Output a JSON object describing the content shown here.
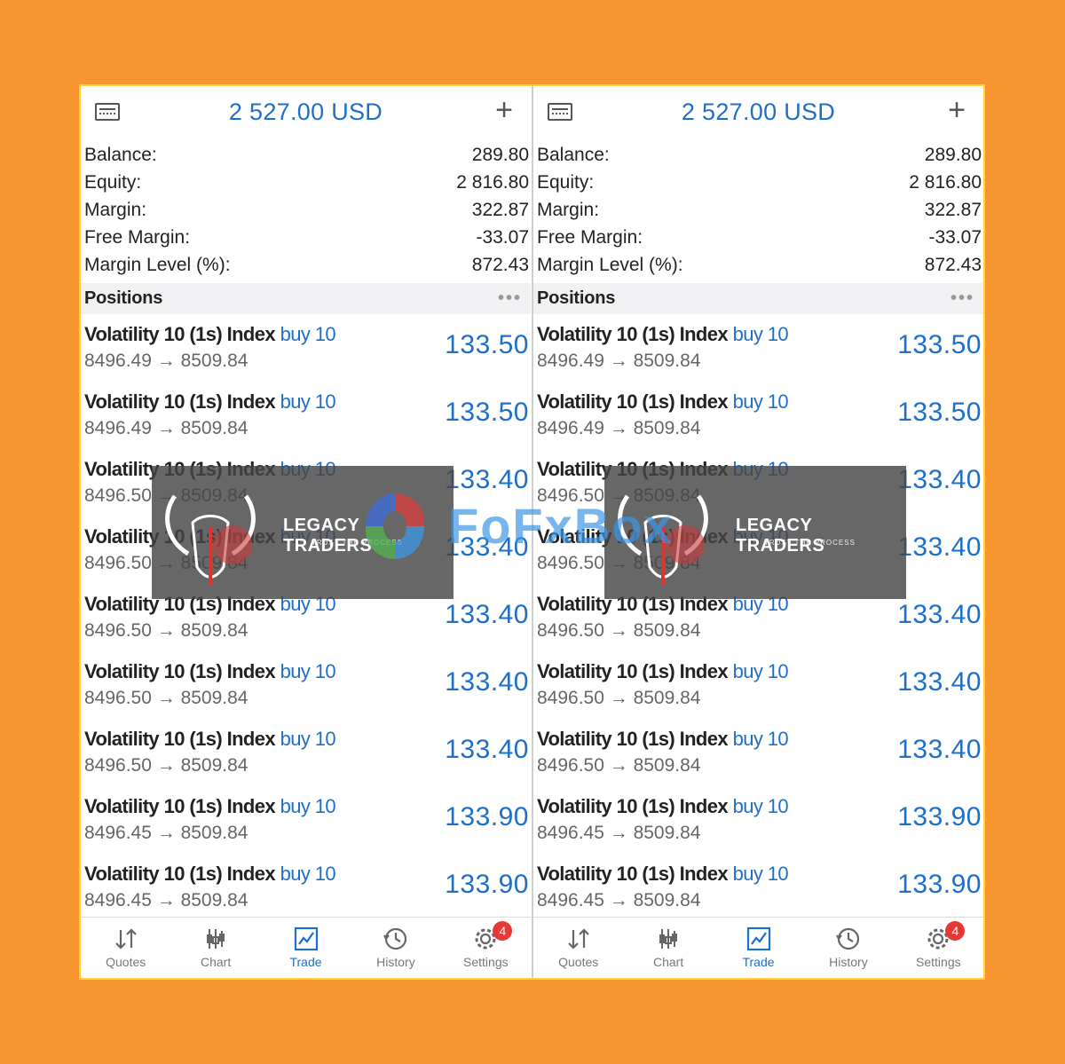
{
  "screens": [
    {
      "title": "2 527.00 USD",
      "summary": [
        {
          "label": "Balance:",
          "value": "289.80"
        },
        {
          "label": "Equity:",
          "value": "2 816.80"
        },
        {
          "label": "Margin:",
          "value": "322.87"
        },
        {
          "label": "Free Margin:",
          "value": "-33.07"
        },
        {
          "label": "Margin Level (%):",
          "value": "872.43"
        }
      ],
      "positions_label": "Positions",
      "positions": [
        {
          "symbol": "Volatility 10 (1s) Index",
          "side": "buy 10",
          "prices": "8496.49 → 8509.84",
          "profit": "133.50"
        },
        {
          "symbol": "Volatility 10 (1s) Index",
          "side": "buy 10",
          "prices": "8496.49 → 8509.84",
          "profit": "133.50"
        },
        {
          "symbol": "Volatility 10 (1s) Index",
          "side": "buy 10",
          "prices": "8496.50 → 8509.84",
          "profit": "133.40"
        },
        {
          "symbol": "Volatility 10 (1s) Index",
          "side": "buy 10",
          "prices": "8496.50 → 8509.84",
          "profit": "133.40"
        },
        {
          "symbol": "Volatility 10 (1s) Index",
          "side": "buy 10",
          "prices": "8496.50 → 8509.84",
          "profit": "133.40"
        },
        {
          "symbol": "Volatility 10 (1s) Index",
          "side": "buy 10",
          "prices": "8496.50 → 8509.84",
          "profit": "133.40"
        },
        {
          "symbol": "Volatility 10 (1s) Index",
          "side": "buy 10",
          "prices": "8496.50 → 8509.84",
          "profit": "133.40"
        },
        {
          "symbol": "Volatility 10 (1s) Index",
          "side": "buy 10",
          "prices": "8496.45 → 8509.84",
          "profit": "133.90"
        },
        {
          "symbol": "Volatility 10 (1s) Index",
          "side": "buy 10",
          "prices": "8496.45 → 8509.84",
          "profit": "133.90"
        }
      ],
      "tabs": [
        "Quotes",
        "Chart",
        "Trade",
        "History",
        "Settings"
      ],
      "settings_badge": "4",
      "watermark": {
        "title": "LEGACY TRADERS",
        "subtitle": "TRUST THE PROCESS"
      }
    },
    {
      "title": "2 527.00 USD",
      "summary": [
        {
          "label": "Balance:",
          "value": "289.80"
        },
        {
          "label": "Equity:",
          "value": "2 816.80"
        },
        {
          "label": "Margin:",
          "value": "322.87"
        },
        {
          "label": "Free Margin:",
          "value": "-33.07"
        },
        {
          "label": "Margin Level (%):",
          "value": "872.43"
        }
      ],
      "positions_label": "Positions",
      "positions": [
        {
          "symbol": "Volatility 10 (1s) Index",
          "side": "buy 10",
          "prices": "8496.49 → 8509.84",
          "profit": "133.50"
        },
        {
          "symbol": "Volatility 10 (1s) Index",
          "side": "buy 10",
          "prices": "8496.49 → 8509.84",
          "profit": "133.50"
        },
        {
          "symbol": "Volatility 10 (1s) Index",
          "side": "buy 10",
          "prices": "8496.50 → 8509.84",
          "profit": "133.40"
        },
        {
          "symbol": "Volatility 10 (1s) Index",
          "side": "buy 10",
          "prices": "8496.50 → 8509.84",
          "profit": "133.40"
        },
        {
          "symbol": "Volatility 10 (1s) Index",
          "side": "buy 10",
          "prices": "8496.50 → 8509.84",
          "profit": "133.40"
        },
        {
          "symbol": "Volatility 10 (1s) Index",
          "side": "buy 10",
          "prices": "8496.50 → 8509.84",
          "profit": "133.40"
        },
        {
          "symbol": "Volatility 10 (1s) Index",
          "side": "buy 10",
          "prices": "8496.50 → 8509.84",
          "profit": "133.40"
        },
        {
          "symbol": "Volatility 10 (1s) Index",
          "side": "buy 10",
          "prices": "8496.45 → 8509.84",
          "profit": "133.90"
        },
        {
          "symbol": "Volatility 10 (1s) Index",
          "side": "buy 10",
          "prices": "8496.45 → 8509.84",
          "profit": "133.90"
        }
      ],
      "tabs": [
        "Quotes",
        "Chart",
        "Trade",
        "History",
        "Settings"
      ],
      "settings_badge": "4",
      "watermark": {
        "title": "LEGACY TRADERS",
        "subtitle": "TRUST THE PROCESS"
      }
    }
  ],
  "active_tab": "Trade",
  "overlay_brand": "FoFxBox",
  "colors": {
    "accent": "#1E6FC8",
    "background": "#F7962F",
    "frame": "#FFD23F",
    "badge": "#E53935"
  },
  "icons": [
    "wallet-icon",
    "plus-icon",
    "more-dots-icon",
    "quotes-icon",
    "chart-icon",
    "trade-icon",
    "history-icon",
    "settings-icon"
  ]
}
